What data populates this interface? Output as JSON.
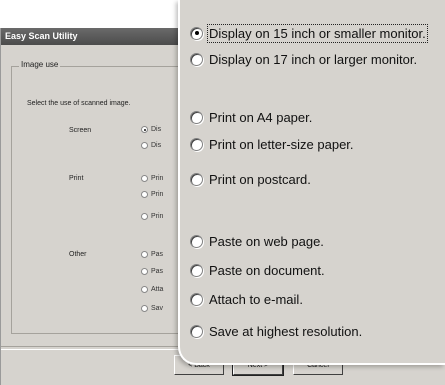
{
  "window": {
    "title": "Easy Scan Utility"
  },
  "group": {
    "title": "Image use"
  },
  "instruction": "Select the use of scanned image.",
  "categories": {
    "screen": "Screen",
    "print": "Print",
    "other": "Other"
  },
  "mini_options": [
    "Dis",
    "Dis",
    "Prin",
    "Prin",
    "Prin",
    "Pas",
    "Pas",
    "Atta",
    "Sav"
  ],
  "options": [
    {
      "label": "Display on 15 inch or smaller monitor.",
      "selected": true
    },
    {
      "label": "Display on 17 inch or larger monitor.",
      "selected": false
    },
    {
      "label": "Print on A4 paper.",
      "selected": false
    },
    {
      "label": "Print on letter-size paper.",
      "selected": false
    },
    {
      "label": "Print on postcard.",
      "selected": false
    },
    {
      "label": "Paste on web page.",
      "selected": false
    },
    {
      "label": "Paste on document.",
      "selected": false
    },
    {
      "label": "Attach to e-mail.",
      "selected": false
    },
    {
      "label": "Save at highest resolution.",
      "selected": false
    }
  ],
  "buttons": {
    "back": "< Back",
    "next": "Next >",
    "cancel": "Cancel"
  }
}
